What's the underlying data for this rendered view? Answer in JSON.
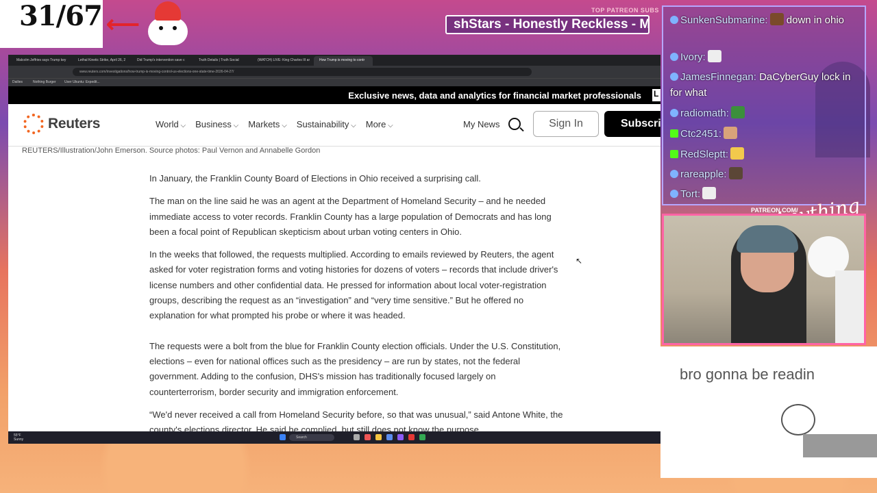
{
  "overlay": {
    "counter": "31/67",
    "patreon_label": "TOP PATREON SUBS",
    "ticker": "shStars - Honestly Reckless - Mo",
    "patreon_url": "PATREON.COM/",
    "brand_script": "Anything else"
  },
  "browser": {
    "tabs": [
      "Malcolm Jeffries says Trump key",
      "Lethal Kinetic Strike, April 26, 2",
      "Did Trump's intervention save c",
      "Truth Details | Truth Social",
      "(WATCH) LIVE: King Charles III arr",
      "How Trump is moving to contr"
    ],
    "url": "www.reuters.com/investigations/how-trump-is-moving-control-us-elections-one-state-time-2026-04-27/",
    "bookmarks": [
      "Dailies",
      "Nothing Burger",
      "User Ubuntu: Expedit..."
    ],
    "promo": {
      "text": "Exclusive news, data and analytics for financial market professionals",
      "tag": "L"
    },
    "header": {
      "logo": "Reuters",
      "nav": [
        "World",
        "Business",
        "Markets",
        "Sustainability",
        "More"
      ],
      "my_news": "My News",
      "sign_in": "Sign In",
      "subscribe": "Subscrib"
    },
    "caption": "REUTERS/Illustration/John Emerson. Source photos: Paul Vernon and Annabelle Gordon",
    "article": [
      "In January, the Franklin County Board of Elections in Ohio received a surprising call.",
      "The man on the line said he was an agent at the Department of Homeland Security – and he needed immediate access to voter records. Franklin County has a large population of Democrats and has long been a focal point of Republican skepticism about urban voting centers in Ohio.",
      "In the weeks that followed, the requests multiplied. According to emails reviewed by Reuters, the agent asked for voter registration forms and voting histories for dozens of voters – records that include driver's license numbers and other confidential data. He pressed for information about local voter-registration groups, describing the request as an “investigation” and “very time sensitive.” But he offered no explanation for what prompted his probe or where it was headed.",
      "The requests were a bolt from the blue for Franklin County election officials. Under the U.S. Constitution, elections – even for national offices such as the presidency – are run by states, not the federal government. Adding to the confusion, DHS's mission has traditionally focused largely on counterterrorism, border security and immigration enforcement.",
      "“We'd never received a call from Homeland Security before, so that was unusual,” said Antone White, the county's elections director. He said he complied, but still does not know the purpose"
    ],
    "taskbar": {
      "weather_temp": "55°F",
      "weather_desc": "Sunny",
      "search": "Search"
    }
  },
  "chat": [
    {
      "badge": "blue",
      "name": "SunkenSubmarine:",
      "text": " down in ohio",
      "emote": "#7a4a2a"
    },
    {
      "badge": "blue",
      "name": "Ivory:",
      "text": "",
      "emote": "#eeeeee"
    },
    {
      "badge": "blue",
      "name": "JamesFinnegan:",
      "text": " DaCyberGuy lock in for what",
      "emote": ""
    },
    {
      "badge": "blue",
      "name": "radiomath:",
      "text": "",
      "emote": "#3c8f3c"
    },
    {
      "badge": "kick",
      "name": "Ctc2451:",
      "text": "",
      "emote": "#d9a37a"
    },
    {
      "badge": "kick",
      "name": "RedSleptt:",
      "text": "",
      "emote": "#f2c94c"
    },
    {
      "badge": "blue",
      "name": "rareapple:",
      "text": "",
      "emote": "#5b4636"
    },
    {
      "badge": "blue",
      "name": "Tort:",
      "text": "",
      "emote": "#eeeeee"
    }
  ],
  "caption_box": "bro gonna be readin"
}
